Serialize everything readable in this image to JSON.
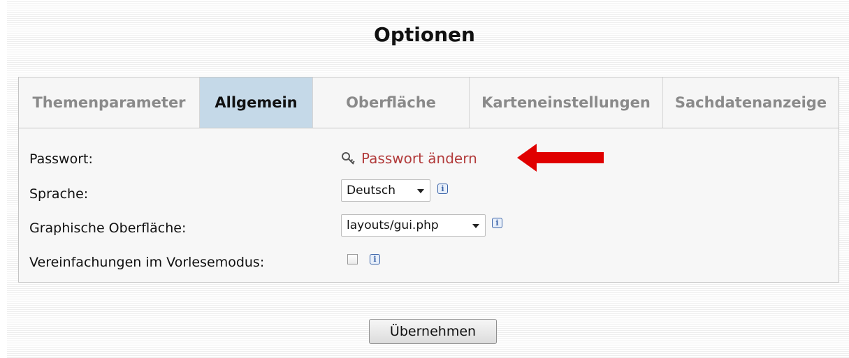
{
  "page": {
    "title": "Optionen"
  },
  "tabs": [
    {
      "label": "Themenparameter",
      "active": false
    },
    {
      "label": "Allgemein",
      "active": true
    },
    {
      "label": "Oberfläche",
      "active": false
    },
    {
      "label": "Karteneinstellungen",
      "active": false
    },
    {
      "label": "Sachdatenanzeige",
      "active": false
    }
  ],
  "form": {
    "password_label": "Passwort:",
    "password_link": "Passwort ändern",
    "language_label": "Sprache:",
    "language_value": "Deutsch",
    "gui_label": "Graphische Oberfläche:",
    "gui_value": "layouts/gui.php",
    "reader_label": "Vereinfachungen im Vorlesemodus:",
    "reader_checked": false,
    "info_glyph": "i"
  },
  "actions": {
    "apply_label": "Übernehmen"
  },
  "icons": {
    "key": "key-icon",
    "info": "info-icon",
    "arrow": "red-arrow-icon"
  },
  "colors": {
    "active_tab": "#c5d9e8",
    "link": "#b23b3b",
    "arrow": "#e00000"
  }
}
